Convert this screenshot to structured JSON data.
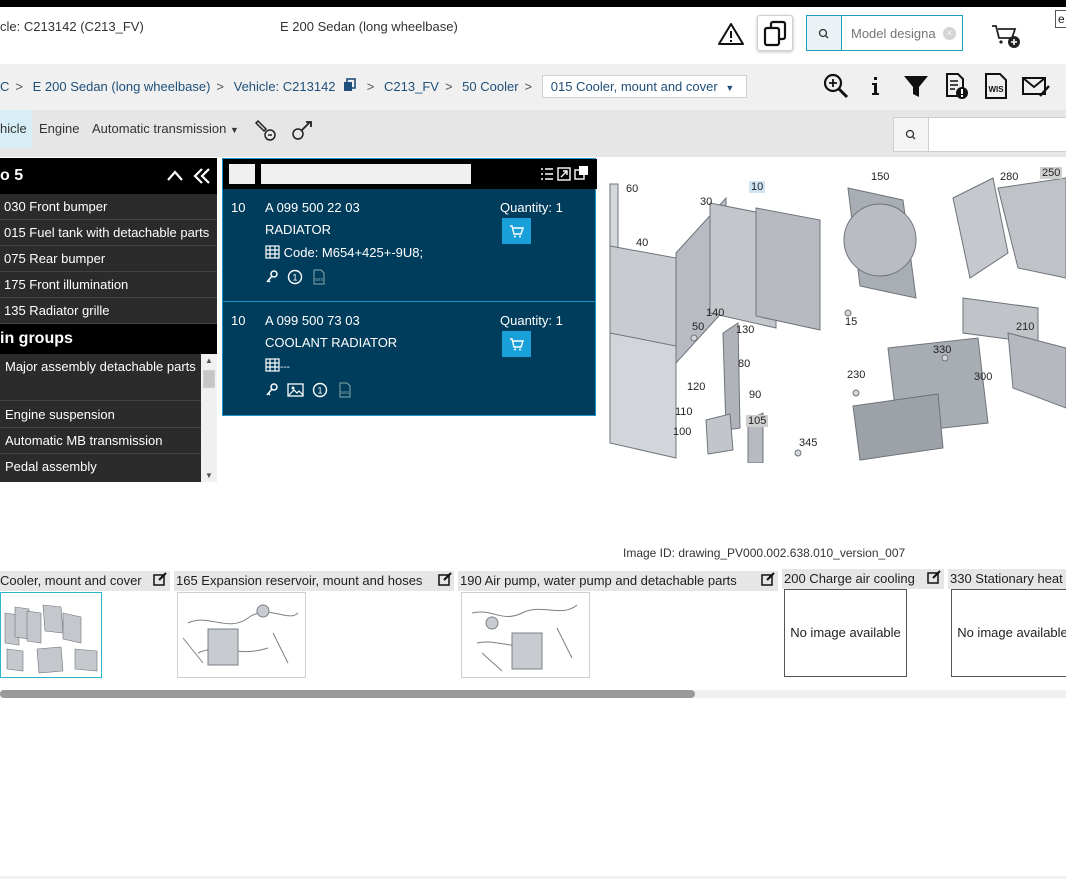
{
  "header": {
    "vehicle_label": "cle: C213142 (C213_FV)",
    "model_label": "E 200 Sedan (long wheelbase)",
    "search_placeholder": "Model designa",
    "lang": "e"
  },
  "breadcrumb": {
    "items": [
      "C",
      "E 200 Sedan (long wheelbase)",
      "Vehicle: C213142",
      "C213_FV",
      "50 Cooler"
    ],
    "current": "015 Cooler, mount and cover"
  },
  "tabs": {
    "items": [
      "hicle",
      "Engine",
      "Automatic transmission"
    ]
  },
  "left_panel": {
    "title": "o 5",
    "items": [
      "030 Front bumper",
      "015 Fuel tank with detachable parts",
      "075 Rear bumper",
      "175 Front illumination",
      "135 Radiator grille"
    ],
    "groups_title": "in groups",
    "groups": [
      "Major assembly detachable parts",
      "Engine suspension",
      "Automatic MB transmission",
      "Pedal assembly"
    ]
  },
  "parts": [
    {
      "pos": "10",
      "number": "A 099 500 22 03",
      "name": "RADIATOR",
      "code": "Code: M654+425+-9U8;",
      "quantity": "Quantity: 1"
    },
    {
      "pos": "10",
      "number": "A 099 500 73 03",
      "name": "COOLANT RADIATOR",
      "code": "---",
      "quantity": "Quantity: 1"
    }
  ],
  "drawing": {
    "callouts": [
      "60",
      "10",
      "30",
      "150",
      "280",
      "250",
      "40",
      "140",
      "50",
      "130",
      "15",
      "210",
      "80",
      "330",
      "230",
      "300",
      "120",
      "90",
      "110",
      "105",
      "100",
      "345"
    ],
    "image_id": "Image ID: drawing_PV000.002.638.010_version_007"
  },
  "strip": {
    "items": [
      {
        "label": "Cooler, mount and cover"
      },
      {
        "label": "165 Expansion reservoir, mount and hoses"
      },
      {
        "label": "190 Air pump, water pump and detachable parts"
      },
      {
        "label": "200 Charge air cooling",
        "no_image": "No image available"
      },
      {
        "label": "330 Stationary heat",
        "no_image": "No image available"
      }
    ]
  }
}
